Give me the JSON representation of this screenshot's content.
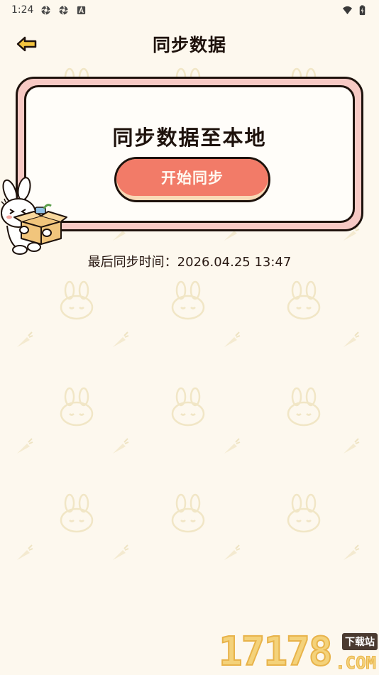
{
  "status_bar": {
    "time": "1:24",
    "icons": [
      "gear-icon",
      "gear-icon",
      "font-icon",
      "wifi-icon",
      "battery-charging-icon"
    ]
  },
  "header": {
    "title": "同步数据",
    "back_icon": "back-arrow-icon"
  },
  "card": {
    "heading": "同步数据至本地",
    "button_label": "开始同步",
    "mascot": "bunny-carrying-box-illustration"
  },
  "last_sync": {
    "label": "最后同步时间：",
    "value": "2026.04.25 13:47"
  },
  "watermark": {
    "number": "17178",
    "tag": "下载站",
    "suffix": ".COM"
  },
  "colors": {
    "background": "#fdf8ee",
    "card_border_fill": "#f7c9c4",
    "button": "#f27b68",
    "button_shadow": "#f9d9b6",
    "ink": "#1e120c"
  }
}
